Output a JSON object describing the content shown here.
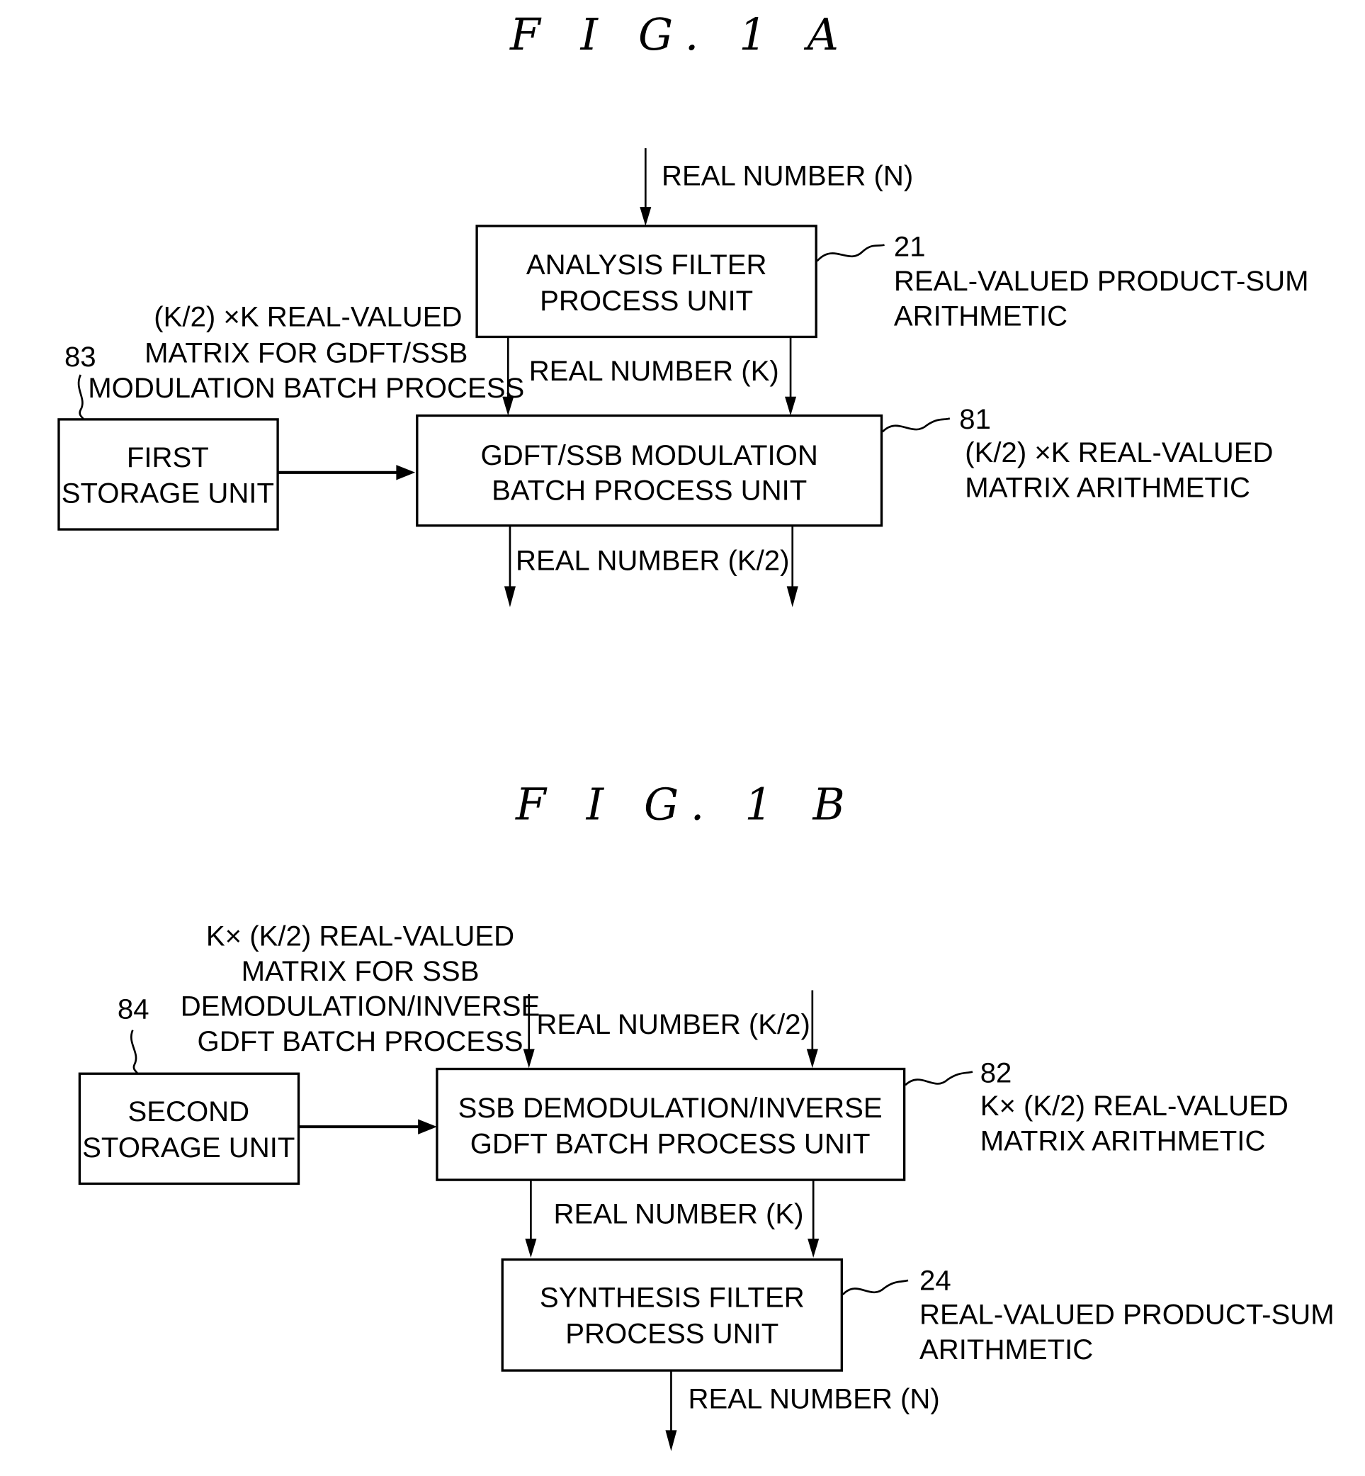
{
  "figure_a": {
    "title": "F I G. 1 A",
    "input_label": "REAL NUMBER (N)",
    "analysis_box": {
      "ref": "21",
      "lines": [
        "ANALYSIS FILTER",
        "PROCESS UNIT"
      ],
      "note": [
        "REAL-VALUED PRODUCT-SUM",
        "ARITHMETIC"
      ]
    },
    "mid_label": "REAL NUMBER (K)",
    "matrix_note": [
      "(K/2) ×K REAL-VALUED",
      "MATRIX FOR GDFT/SSB",
      "MODULATION BATCH PROCESS"
    ],
    "storage_box": {
      "ref": "83",
      "lines": [
        "FIRST",
        "STORAGE UNIT"
      ]
    },
    "gdft_box": {
      "ref": "81",
      "lines": [
        "GDFT/SSB MODULATION",
        "BATCH PROCESS UNIT"
      ],
      "note": [
        "(K/2) ×K REAL-VALUED",
        "MATRIX ARITHMETIC"
      ]
    },
    "output_label": "REAL NUMBER (K/2)"
  },
  "figure_b": {
    "title": "F I G. 1 B",
    "matrix_note": [
      "K× (K/2) REAL-VALUED",
      "MATRIX FOR SSB",
      "DEMODULATION/INVERSE",
      "GDFT BATCH PROCESS"
    ],
    "input_label": "REAL NUMBER (K/2)",
    "storage_box": {
      "ref": "84",
      "lines": [
        "SECOND",
        "STORAGE UNIT"
      ]
    },
    "ssb_box": {
      "ref": "82",
      "lines": [
        "SSB DEMODULATION/INVERSE",
        "GDFT BATCH PROCESS UNIT"
      ],
      "note": [
        "K× (K/2) REAL-VALUED",
        "MATRIX ARITHMETIC"
      ]
    },
    "mid_label": "REAL NUMBER (K)",
    "synthesis_box": {
      "ref": "24",
      "lines": [
        "SYNTHESIS FILTER",
        "PROCESS UNIT"
      ],
      "note": [
        "REAL-VALUED PRODUCT-SUM",
        "ARITHMETIC"
      ]
    },
    "output_label": "REAL NUMBER (N)"
  }
}
